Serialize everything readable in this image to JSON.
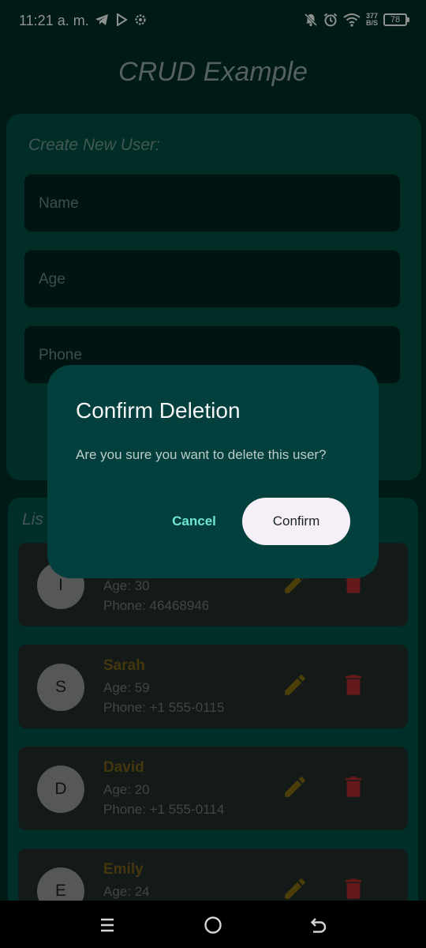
{
  "status_bar": {
    "time": "11:21 a. m.",
    "net_speed_value": "377",
    "net_speed_unit": "B/S",
    "battery": "78"
  },
  "app": {
    "title": "CRUD Example"
  },
  "create_form": {
    "label": "Create New User:",
    "name_placeholder": "Name",
    "age_placeholder": "Age",
    "phone_placeholder": "Phone"
  },
  "user_list": {
    "label": "Lis",
    "users": [
      {
        "initial": "I",
        "name": "",
        "age": "Age: 30",
        "phone": "Phone: 46468946"
      },
      {
        "initial": "S",
        "name": "Sarah",
        "age": "Age: 59",
        "phone": "Phone: +1 555-0115"
      },
      {
        "initial": "D",
        "name": "David",
        "age": "Age: 20",
        "phone": "Phone: +1 555-0114"
      },
      {
        "initial": "E",
        "name": "Emily",
        "age": "Age: 24",
        "phone": ""
      }
    ]
  },
  "dialog": {
    "title": "Confirm Deletion",
    "message": "Are you sure you want to delete this user?",
    "cancel_label": "Cancel",
    "confirm_label": "Confirm"
  },
  "colors": {
    "background": "#012a24",
    "form_card": "#024a3f",
    "list_card": "#014d45",
    "dialog": "#033f3d",
    "accent": "#6ee6d0",
    "edit_icon": "#7a6410",
    "delete_icon": "#a3292b"
  },
  "icons": {
    "status_left": [
      "telegram-icon",
      "play-store-icon",
      "settings-icon"
    ],
    "status_right": [
      "notifications-off-icon",
      "alarm-icon",
      "wifi-icon"
    ],
    "row": [
      "edit-icon",
      "delete-icon"
    ],
    "nav": [
      "recent-apps-icon",
      "home-icon",
      "back-icon"
    ]
  }
}
